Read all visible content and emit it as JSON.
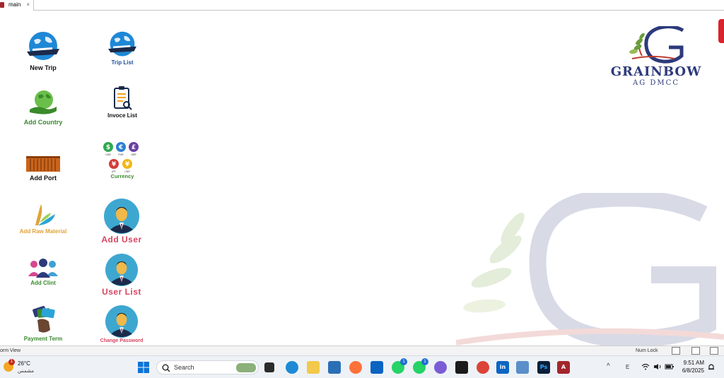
{
  "window": {
    "tab_label": "main",
    "tab_close": "×"
  },
  "tiles": [
    {
      "id": "new-trip",
      "label": "New Trip",
      "icon": "globe-ship-icon",
      "color": "#111111"
    },
    {
      "id": "trip-list",
      "label": "Trip List",
      "icon": "globe-ship-icon",
      "color": "#1f4e9c"
    },
    {
      "id": "add-country",
      "label": "Add Country",
      "icon": "green-globe-hand-icon",
      "color": "#3b8a2f"
    },
    {
      "id": "invoce-list",
      "label": "Invoce List",
      "icon": "clipboard-search-icon",
      "color": "#111111"
    },
    {
      "id": "add-port",
      "label": "Add Port",
      "icon": "shipping-container-icon",
      "color": "#111111"
    },
    {
      "id": "currency",
      "label": "Currency",
      "icon": "currency-coins-icon",
      "color": "#3b8a2f"
    },
    {
      "id": "add-raw-material",
      "label": "Add Raw Material",
      "icon": "wheat-leaf-icon",
      "color": "#e0a33a"
    },
    {
      "id": "add-user",
      "label": "Add User",
      "icon": "user-avatar-icon",
      "color": "#d64561"
    },
    {
      "id": "add-clint",
      "label": "Add Clint",
      "icon": "user-group-icon",
      "color": "#3b8a2f"
    },
    {
      "id": "user-list",
      "label": "User List",
      "icon": "user-avatar-icon",
      "color": "#d64561"
    },
    {
      "id": "payment-term",
      "label": "Payment Term",
      "icon": "hand-cards-icon",
      "color": "#3b8a2f"
    },
    {
      "id": "change-password",
      "label": "Change Password",
      "icon": "user-avatar-icon",
      "color": "#d64561"
    }
  ],
  "currency_codes": [
    "USD",
    "EUR",
    "GBP",
    "JPY",
    "CNY"
  ],
  "currency_symbols": [
    "$",
    "€",
    "£",
    "¥",
    "¥"
  ],
  "logo": {
    "name": "GRAINBOW",
    "subtitle": "AG DMCC",
    "brand_color": "#2d3a7b"
  },
  "statusbar": {
    "left": "orm View",
    "num_lock": "Num Lock"
  },
  "taskbar": {
    "weather_temp": "26°C",
    "weather_desc": "مشمس",
    "weather_badge": "1",
    "search_placeholder": "Search",
    "whatsapp_badge_1": "1",
    "whatsapp_badge_2": "1",
    "lang": "E",
    "time": "9:51 AM",
    "date": "6/8/2025",
    "app_letter_ps": "Ps",
    "app_letter_in": "in",
    "app_letter_a": "A"
  }
}
